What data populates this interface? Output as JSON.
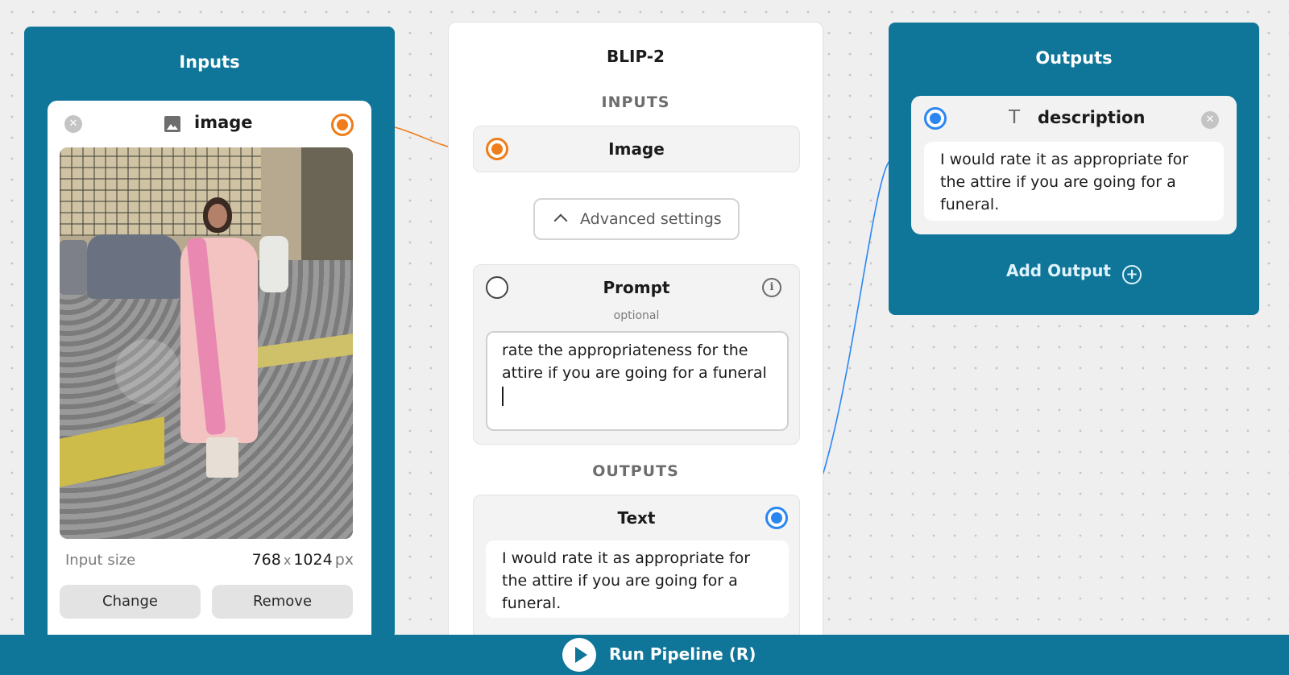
{
  "inputs_panel": {
    "title": "Inputs",
    "image_field": {
      "name": "image",
      "size_label": "Input size",
      "width": "768",
      "separator": "x",
      "height": "1024",
      "unit": "px",
      "change_label": "Change",
      "remove_label": "Remove"
    }
  },
  "model_node": {
    "title": "BLIP-2",
    "inputs_heading": "INPUTS",
    "image_label": "Image",
    "advanced_settings_label": "Advanced settings",
    "prompt": {
      "label": "Prompt",
      "optional_label": "optional",
      "value": "rate the appropriateness for the attire if you are going for a funeral"
    },
    "outputs_heading": "OUTPUTS",
    "text_output": {
      "label": "Text",
      "value": "I would rate it as appropriate for the attire if you are going for a funeral."
    }
  },
  "outputs_panel": {
    "title": "Outputs",
    "description": {
      "name": "description",
      "value": "I would rate it as appropriate for the attire if you are going for a funeral."
    },
    "add_output_label": "Add Output"
  },
  "run_bar": {
    "label": "Run Pipeline (R)"
  },
  "colors": {
    "panel_bg": "#0f7599",
    "image_port": "#ef7d1a",
    "text_port": "#2b86f2"
  }
}
